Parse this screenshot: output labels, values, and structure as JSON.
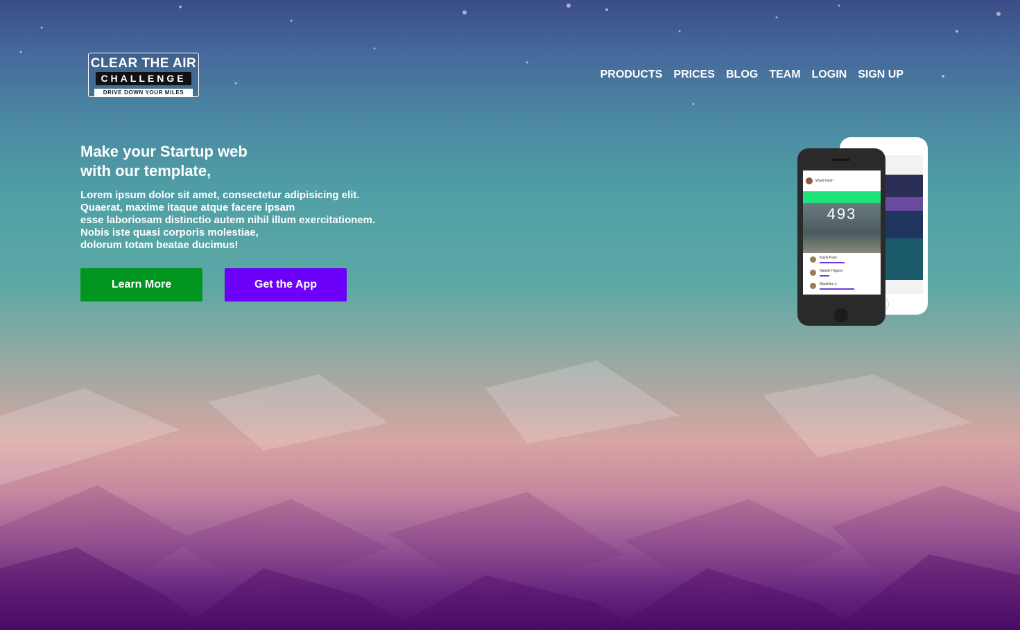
{
  "logo": {
    "line1": "CLEAR THE AIR",
    "line2": "CHALLENGE",
    "line3": "DRIVE DOWN YOUR MILES"
  },
  "nav": {
    "items": [
      {
        "label": "PRODUCTS"
      },
      {
        "label": "PRICES"
      },
      {
        "label": "BLOG"
      },
      {
        "label": "TEAM"
      },
      {
        "label": "LOGIN"
      },
      {
        "label": "SIGN UP"
      }
    ]
  },
  "hero": {
    "title_line1": "Make your Startup web",
    "title_line2": "with our template,",
    "body_lines": [
      "Lorem ipsum dolor sit amet, consectetur adipisicing elit.",
      "Quaerat, maxime itaque atque facere ipsam",
      "esse laboriosam distinctio autem nihil illum exercitationem.",
      "Nobis iste quasi corporis molestiae,",
      "dolorum totam beatae ducimus!"
    ],
    "learn_more_label": "Learn More",
    "get_app_label": "Get the App"
  },
  "phone_mockup": {
    "user": "Wyatt Nash",
    "steps": "493",
    "list": [
      "Kayla Pass",
      "Natalie Higgins",
      "Madeline J."
    ]
  },
  "colors": {
    "learn_more": "#01961f",
    "get_app": "#6c00f8"
  }
}
